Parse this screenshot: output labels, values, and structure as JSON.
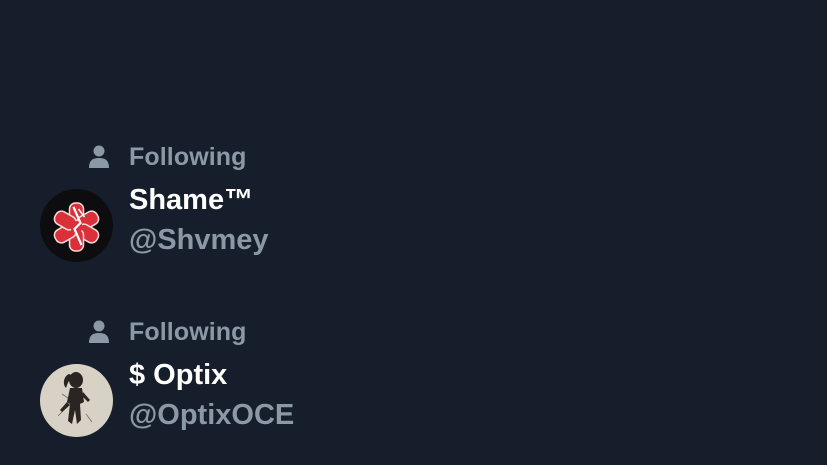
{
  "colors": {
    "background": "#161e2b",
    "primary_text": "#ffffff",
    "secondary_text": "#8b98a5"
  },
  "entries": [
    {
      "status_icon": "person-icon",
      "status_label": "Following",
      "display_name": "Shame™",
      "handle": "@Shvmey",
      "avatar": "red-symbol-avatar"
    },
    {
      "status_icon": "person-icon",
      "status_label": "Following",
      "display_name": "$ Optix",
      "handle": "@OptixOCE",
      "avatar": "figure-sketch-avatar"
    }
  ]
}
